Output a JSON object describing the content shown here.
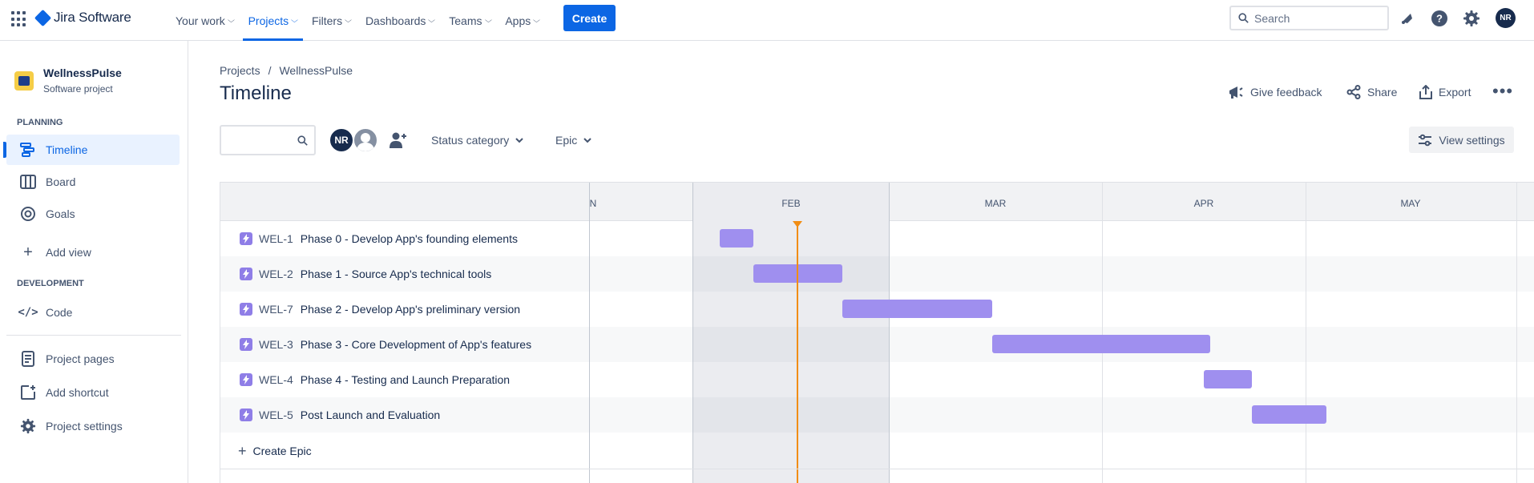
{
  "nav": {
    "brand": "Jira Software",
    "menu": [
      {
        "label": "Your work",
        "active": false
      },
      {
        "label": "Projects",
        "active": true
      },
      {
        "label": "Filters",
        "active": false
      },
      {
        "label": "Dashboards",
        "active": false
      },
      {
        "label": "Teams",
        "active": false
      },
      {
        "label": "Apps",
        "active": false
      }
    ],
    "create_label": "Create",
    "search_placeholder": "Search",
    "user_initials": "NR",
    "accent_color": "#0c66e4"
  },
  "sidebar": {
    "project_name": "WellnessPulse",
    "project_type": "Software project",
    "planning_heading": "PLANNING",
    "planning_items": [
      {
        "label": "Timeline",
        "icon": "timeline-icon",
        "active": true
      },
      {
        "label": "Board",
        "icon": "board-icon",
        "active": false
      },
      {
        "label": "Goals",
        "icon": "goals-icon",
        "active": false
      }
    ],
    "add_view_label": "Add view",
    "development_heading": "DEVELOPMENT",
    "code_label": "Code",
    "bottom_items": [
      {
        "label": "Project pages",
        "icon": "page-icon"
      },
      {
        "label": "Add shortcut",
        "icon": "add-shortcut-icon"
      },
      {
        "label": "Project settings",
        "icon": "gear-icon"
      }
    ]
  },
  "header": {
    "breadcrumb": [
      "Projects",
      "WellnessPulse"
    ],
    "breadcrumb_separator": "/",
    "title": "Timeline",
    "actions": {
      "feedback": "Give feedback",
      "share": "Share",
      "export": "Export"
    }
  },
  "filters": {
    "search_value": "",
    "avatar_initials": "NR",
    "status_category": "Status category",
    "epic": "Epic",
    "view_settings": "View settings"
  },
  "timeline": {
    "months": [
      "N",
      "FEB",
      "MAR",
      "APR",
      "MAY"
    ],
    "current_month": "FEB",
    "bar_color": "#9f8fef",
    "today_color": "#f18d13",
    "epics": [
      {
        "key": "WEL-1",
        "summary": "Phase 0 - Develop App's founding elements"
      },
      {
        "key": "WEL-2",
        "summary": "Phase 1 - Source App's technical tools"
      },
      {
        "key": "WEL-7",
        "summary": "Phase 2 - Develop App's preliminary version"
      },
      {
        "key": "WEL-3",
        "summary": "Phase 3 - Core Development of App's features"
      },
      {
        "key": "WEL-4",
        "summary": "Phase 4 - Testing and Launch Preparation"
      },
      {
        "key": "WEL-5",
        "summary": "Post Launch and Evaluation"
      }
    ],
    "create_epic_label": "Create Epic"
  }
}
